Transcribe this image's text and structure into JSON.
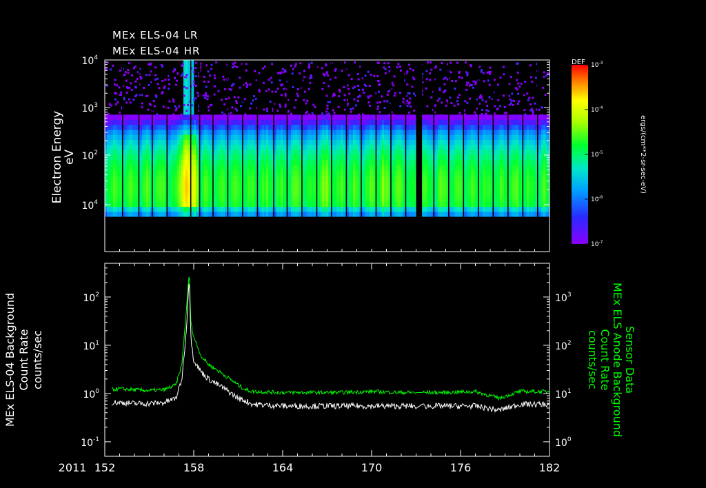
{
  "chart_data": [
    {
      "type": "heatmap",
      "title_lines": [
        "MEx ELS-04 LR",
        "MEx ELS-04 HR"
      ],
      "ylabel_lines": [
        "Electron Energy",
        "eV"
      ],
      "y_scale": "log",
      "yticks": [
        {
          "base": "10",
          "exp": "4",
          "value": 10
        },
        {
          "base": "10",
          "exp": "2",
          "value": 100
        },
        {
          "base": "10",
          "exp": "3",
          "value": 1000
        },
        {
          "base": "10",
          "exp": "4",
          "value": 10000
        }
      ],
      "ylim": [
        1,
        30000
      ],
      "xlim": [
        152,
        182
      ],
      "colorbar": {
        "title": "DEF",
        "label": "ergs/(cm**2-sr-sec-eV)",
        "scale": "log",
        "range": [
          1e-07,
          0.001
        ],
        "ticks": [
          {
            "base": "10",
            "exp": "-3",
            "value": 0.001
          },
          {
            "base": "10",
            "exp": "-4",
            "value": 0.0001
          },
          {
            "base": "10",
            "exp": "-5",
            "value": 1e-05
          },
          {
            "base": "10",
            "exp": "-6",
            "value": 1e-06
          },
          {
            "base": "10",
            "exp": "-7",
            "value": 1e-07
          }
        ]
      },
      "features": {
        "bright_event_day": 157.6,
        "data_gap": [
          173.0,
          173.4
        ],
        "orbit_boundaries": [
          153.2,
          154.3,
          155.2,
          156.2,
          157.8,
          158.4,
          159.3,
          160.3,
          161.3,
          162.3,
          163.4,
          164.3,
          165.3,
          166.3,
          167.3,
          168.3,
          169.3,
          170.3,
          171.3,
          172.3,
          174.2,
          175.2,
          176.2,
          177.2,
          178.2,
          179.2,
          180.2,
          181.2
        ],
        "dominant_energy_eV": [
          5,
          300
        ]
      }
    },
    {
      "type": "line",
      "y_scale": "log",
      "left_axis": {
        "label_lines": [
          "MEx ELS-04 Background",
          "Count Rate",
          "counts/sec"
        ],
        "ylim": [
          0.05,
          500
        ],
        "ticks": [
          {
            "base": "10",
            "exp": "2",
            "value": 100
          },
          {
            "base": "10",
            "exp": "1",
            "value": 10
          },
          {
            "base": "10",
            "exp": "0",
            "value": 1
          },
          {
            "base": "10",
            "exp": "-1",
            "value": 0.1
          }
        ]
      },
      "right_axis": {
        "label_lines": [
          "Sensor Data",
          "MEx ELS Anode Background",
          "Count Rate",
          "counts/sec"
        ],
        "ylim": [
          0.5,
          5000
        ],
        "color": "#00ff00",
        "ticks": [
          {
            "base": "10",
            "exp": "3",
            "value": 1000
          },
          {
            "base": "10",
            "exp": "2",
            "value": 100
          },
          {
            "base": "10",
            "exp": "1",
            "value": 10
          },
          {
            "base": "10",
            "exp": "0",
            "value": 1
          }
        ]
      },
      "x_year": "2011",
      "xticks": [
        "152",
        "158",
        "164",
        "170",
        "176",
        "182"
      ],
      "xlim": [
        152,
        182
      ],
      "series": [
        {
          "color": "#ffffff",
          "axis": "left",
          "x": [
            152.1,
            153,
            154,
            155,
            156,
            156.8,
            157.2,
            157.5,
            157.7,
            157.8,
            158.0,
            158.5,
            159,
            160,
            161,
            161.5,
            162,
            164,
            166,
            168,
            170,
            172,
            173.0,
            173.4,
            175,
            177,
            178.6,
            180,
            182
          ],
          "y": [
            0.65,
            0.65,
            0.62,
            0.62,
            0.65,
            0.8,
            2,
            20,
            300,
            15,
            5,
            2.8,
            2.0,
            1.3,
            0.8,
            0.7,
            0.6,
            0.55,
            0.55,
            0.55,
            0.55,
            0.55,
            0.55,
            0.55,
            0.55,
            0.55,
            0.45,
            0.6,
            0.6
          ]
        },
        {
          "color": "#00ff00",
          "axis": "right",
          "x": [
            152.1,
            153,
            154,
            155,
            156,
            156.8,
            157.2,
            157.5,
            157.7,
            157.8,
            158.0,
            158.5,
            159,
            160,
            161,
            161.5,
            162,
            164,
            166,
            168,
            170,
            172,
            173.0,
            173.4,
            175,
            177,
            178.6,
            180,
            182
          ],
          "y": [
            12,
            12.5,
            12,
            11.5,
            12,
            15,
            40,
            500,
            3500,
            300,
            150,
            60,
            40,
            25,
            15,
            12,
            11,
            10.5,
            10.5,
            10.5,
            11,
            10.5,
            10.5,
            10.5,
            10.5,
            11,
            8,
            11,
            11
          ]
        }
      ]
    }
  ]
}
